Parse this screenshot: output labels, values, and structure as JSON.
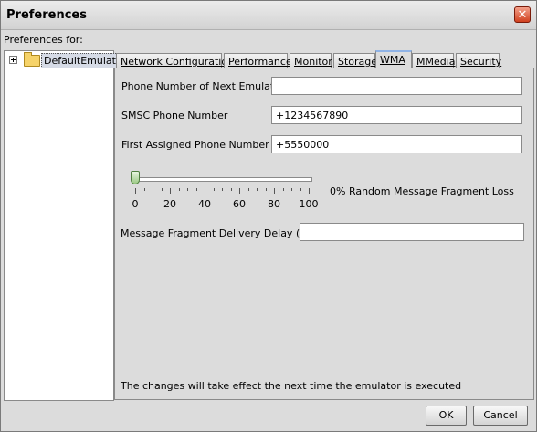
{
  "window": {
    "title": "Preferences",
    "close_label": "✕"
  },
  "sidebar": {
    "label": "Preferences for:",
    "tree": [
      {
        "label": "DefaultEmulator",
        "expander": "+",
        "icon": "folder-icon"
      }
    ]
  },
  "tabs": [
    {
      "label": "Network Configuration"
    },
    {
      "label": "Performance"
    },
    {
      "label": "Monitor"
    },
    {
      "label": "Storage"
    },
    {
      "label": "WMA",
      "active": true
    },
    {
      "label": "MMedia"
    },
    {
      "label": "Security"
    }
  ],
  "wma": {
    "phone_next": {
      "label": "Phone Number of Next Emulator :",
      "value": ""
    },
    "smsc": {
      "label": "SMSC Phone Number",
      "value": "+1234567890"
    },
    "first_assigned": {
      "label": "First Assigned Phone Number",
      "value": "+5550000"
    },
    "fragment_loss": {
      "value": 0,
      "min": 0,
      "max": 100,
      "tick_labels": [
        "0",
        "20",
        "40",
        "60",
        "80",
        "100"
      ],
      "caption": "0% Random Message Fragment Loss"
    },
    "delay": {
      "label": "Message Fragment Delivery Delay (ms):",
      "value": ""
    },
    "note": "The changes will take effect the next time the emulator is executed"
  },
  "buttons": {
    "ok": "OK",
    "cancel": "Cancel"
  }
}
